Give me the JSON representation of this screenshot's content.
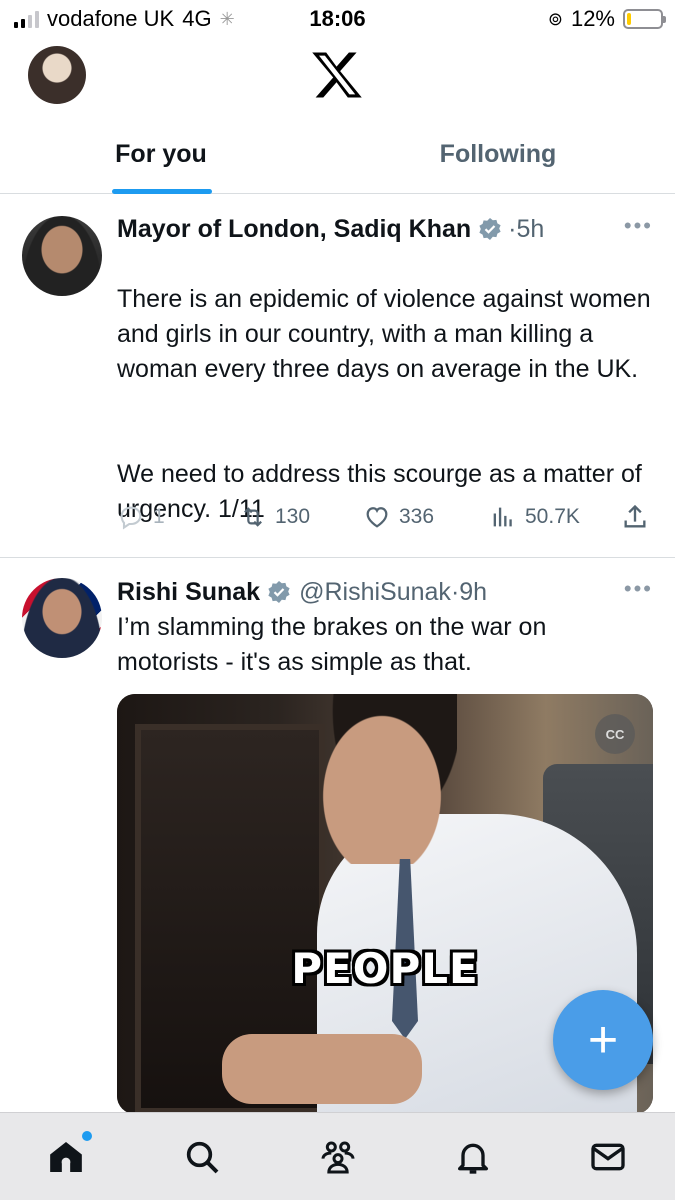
{
  "status_bar": {
    "carrier": "vodafone UK",
    "network": "4G",
    "time": "18:06",
    "battery": "12%",
    "battery_level": 0.12
  },
  "header": {
    "logo_icon": "x-logo-icon",
    "profile_icon": "profile-avatar"
  },
  "tabs": [
    {
      "label": "For you",
      "active": true
    },
    {
      "label": "Following",
      "active": false
    }
  ],
  "tweets": [
    {
      "name": "Mayor of London, Sadiq Khan",
      "verified": true,
      "handle": "",
      "time": "5h",
      "text_p1": "There is an epidemic of violence against women and girls in our country, with a man killing a woman every three days on average in the UK.",
      "text_p2": "We need to address this scourge as a matter of urgency. 1/11",
      "replies": "1",
      "retweets": "130",
      "likes": "336",
      "views": "50.7K"
    },
    {
      "name": "Rishi Sunak",
      "verified": true,
      "handle": "@RishiSunak",
      "time": "9h",
      "text": "I’m slamming the brakes on the war on motorists - it's as simple as that.",
      "media_caption": "PEOPLE",
      "cc_label": "CC"
    }
  ],
  "more_label": "•••",
  "fab_label": "+",
  "nav": [
    "home-icon",
    "search-icon",
    "communities-icon",
    "notifications-icon",
    "messages-icon"
  ],
  "colors": {
    "accent": "#1d9bf0",
    "fab": "#4a9de8",
    "text": "#0f1419",
    "muted": "#536471"
  }
}
